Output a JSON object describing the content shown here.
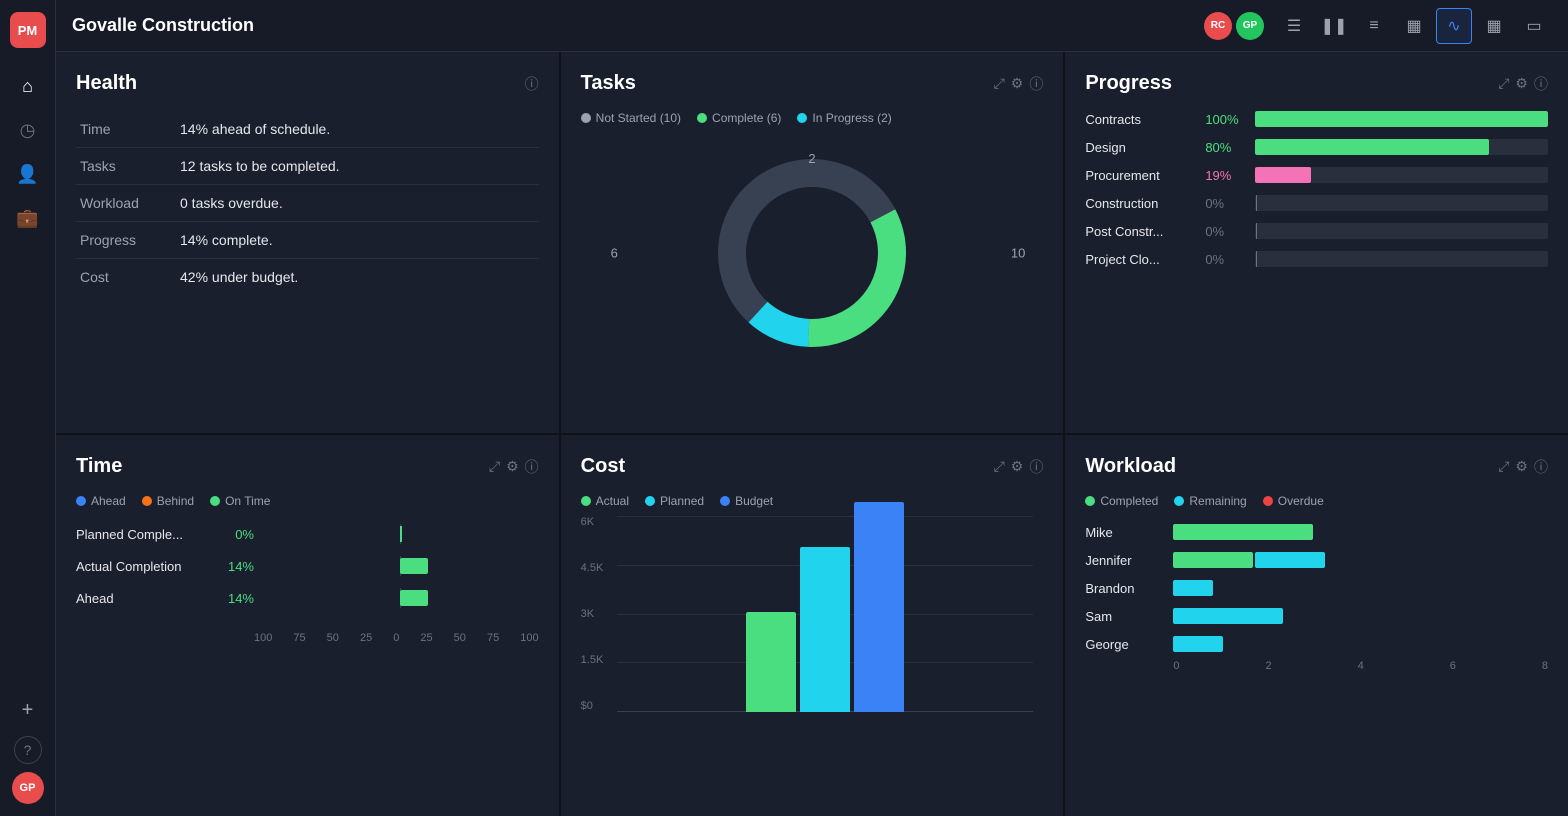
{
  "app": {
    "logo": "PM",
    "title": "Govalle Construction"
  },
  "header": {
    "avatars": [
      {
        "initials": "RC",
        "color": "#e84c4c"
      },
      {
        "initials": "GP",
        "color": "#22c55e"
      }
    ],
    "tools": [
      {
        "name": "list-icon",
        "symbol": "☰",
        "active": false
      },
      {
        "name": "columns-icon",
        "symbol": "⦀",
        "active": false
      },
      {
        "name": "menu-icon",
        "symbol": "≡",
        "active": false
      },
      {
        "name": "table-icon",
        "symbol": "⊞",
        "active": false
      },
      {
        "name": "chart-icon",
        "symbol": "∿",
        "active": true
      },
      {
        "name": "calendar-icon",
        "symbol": "▦",
        "active": false
      },
      {
        "name": "file-icon",
        "symbol": "⬜",
        "active": false
      }
    ]
  },
  "health": {
    "title": "Health",
    "rows": [
      {
        "label": "Time",
        "value": "14% ahead of schedule."
      },
      {
        "label": "Tasks",
        "value": "12 tasks to be completed."
      },
      {
        "label": "Workload",
        "value": "0 tasks overdue."
      },
      {
        "label": "Progress",
        "value": "14% complete."
      },
      {
        "label": "Cost",
        "value": "42% under budget."
      }
    ]
  },
  "tasks": {
    "title": "Tasks",
    "legend": [
      {
        "label": "Not Started (10)",
        "color": "#9ca3af"
      },
      {
        "label": "Complete (6)",
        "color": "#4ade80"
      },
      {
        "label": "In Progress (2)",
        "color": "#22d3ee"
      }
    ],
    "donut": {
      "not_started": 10,
      "complete": 6,
      "in_progress": 2,
      "label_left": "6",
      "label_right": "10",
      "label_top": "2"
    }
  },
  "progress": {
    "title": "Progress",
    "rows": [
      {
        "label": "Contracts",
        "pct": "100%",
        "pct_num": 100,
        "color": "#4ade80"
      },
      {
        "label": "Design",
        "pct": "80%",
        "pct_num": 80,
        "color": "#4ade80"
      },
      {
        "label": "Procurement",
        "pct": "19%",
        "pct_num": 19,
        "color": "#f472b6"
      },
      {
        "label": "Construction",
        "pct": "0%",
        "pct_num": 0,
        "color": "#4ade80"
      },
      {
        "label": "Post Constr...",
        "pct": "0%",
        "pct_num": 0,
        "color": "#4ade80"
      },
      {
        "label": "Project Clo...",
        "pct": "0%",
        "pct_num": 0,
        "color": "#4ade80"
      }
    ]
  },
  "time": {
    "title": "Time",
    "legend": [
      {
        "label": "Ahead",
        "color": "#3b82f6"
      },
      {
        "label": "Behind",
        "color": "#f97316"
      },
      {
        "label": "On Time",
        "color": "#4ade80"
      }
    ],
    "rows": [
      {
        "label": "Planned Comple...",
        "pct": "0%",
        "pct_num": 0,
        "color": "#4ade80"
      },
      {
        "label": "Actual Completion",
        "pct": "14%",
        "pct_num": 14,
        "color": "#4ade80"
      },
      {
        "label": "Ahead",
        "pct": "14%",
        "pct_num": 14,
        "color": "#4ade80"
      }
    ],
    "x_axis": [
      "100",
      "75",
      "50",
      "25",
      "0",
      "25",
      "50",
      "75",
      "100"
    ]
  },
  "cost": {
    "title": "Cost",
    "legend": [
      {
        "label": "Actual",
        "color": "#4ade80"
      },
      {
        "label": "Planned",
        "color": "#22d3ee"
      },
      {
        "label": "Budget",
        "color": "#3b82f6"
      }
    ],
    "y_axis": [
      "6K",
      "4.5K",
      "3K",
      "1.5K",
      "$0"
    ],
    "bars": [
      {
        "actual": 45,
        "planned": 72,
        "budget": 95
      }
    ]
  },
  "workload": {
    "title": "Workload",
    "legend": [
      {
        "label": "Completed",
        "color": "#4ade80"
      },
      {
        "label": "Remaining",
        "color": "#22d3ee"
      },
      {
        "label": "Overdue",
        "color": "#ef4444"
      }
    ],
    "rows": [
      {
        "name": "Mike",
        "completed": 140,
        "remaining": 0,
        "overdue": 0
      },
      {
        "name": "Jennifer",
        "completed": 80,
        "remaining": 70,
        "overdue": 0
      },
      {
        "name": "Brandon",
        "completed": 0,
        "remaining": 40,
        "overdue": 0
      },
      {
        "name": "Sam",
        "completed": 0,
        "remaining": 110,
        "overdue": 0
      },
      {
        "name": "George",
        "completed": 0,
        "remaining": 50,
        "overdue": 0
      }
    ],
    "x_axis": [
      "0",
      "2",
      "4",
      "6",
      "8"
    ]
  },
  "sidebar": {
    "items": [
      {
        "name": "home-icon",
        "symbol": "⌂"
      },
      {
        "name": "clock-icon",
        "symbol": "◷"
      },
      {
        "name": "users-icon",
        "symbol": "👤"
      },
      {
        "name": "briefcase-icon",
        "symbol": "💼"
      }
    ],
    "bottom": [
      {
        "name": "plus-icon",
        "symbol": "+"
      },
      {
        "name": "help-icon",
        "symbol": "?"
      },
      {
        "name": "user-avatar",
        "initials": "GP",
        "color": "#e84c4c"
      }
    ]
  }
}
